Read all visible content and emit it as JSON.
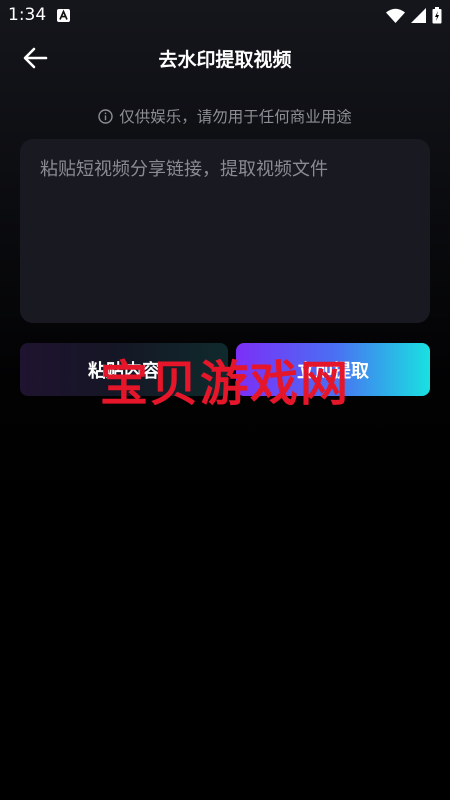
{
  "status_bar": {
    "time": "1:34",
    "icons": [
      "a-notification-icon",
      "wifi-icon",
      "signal-icon",
      "battery-icon"
    ]
  },
  "header": {
    "title": "去水印提取视频",
    "back_icon": "arrow-left-icon"
  },
  "disclaimer": {
    "icon": "info-icon",
    "text": "仅供娱乐，请勿用于任何商业用途"
  },
  "link_input": {
    "placeholder": "粘贴短视频分享链接，提取视频文件",
    "value": ""
  },
  "buttons": {
    "paste_label": "粘贴内容",
    "extract_label": "立即提取"
  },
  "watermark": {
    "text": "宝贝游戏网"
  },
  "colors": {
    "background": "#000000",
    "input_bg": "#191922",
    "gradient_start": "#7b2ff7",
    "gradient_end": "#19e1e0",
    "watermark": "#e5162a"
  }
}
